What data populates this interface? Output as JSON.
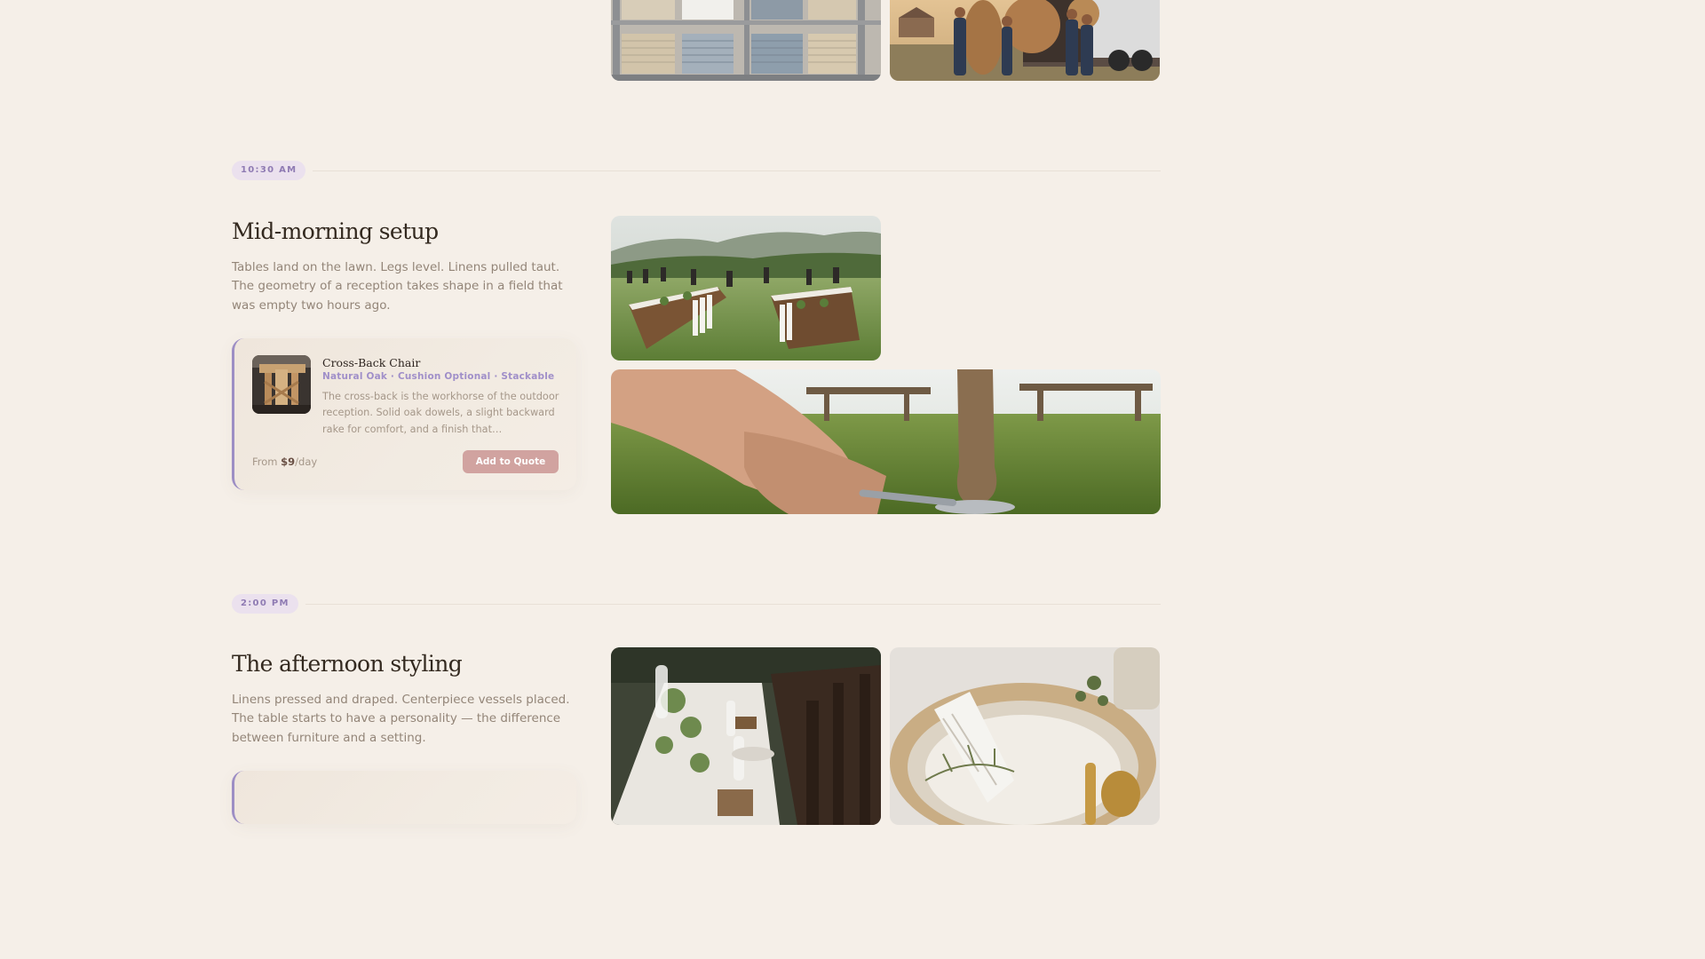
{
  "sections": [
    {
      "time": "10:30 AM",
      "title": "Mid-morning setup",
      "description": "Tables land on the lawn. Legs level. Linens pulled taut. The geometry of a reception takes shape in a field that was empty two hours ago.",
      "product": {
        "name": "Cross-Back Chair",
        "tags": "Natural Oak · Cushion Optional · Stackable",
        "description": "The cross-back is the workhorse of the outdoor reception. Solid oak dowels, a slight backward rake for comfort, and a finish that…",
        "price_prefix": "From ",
        "price": "$9",
        "price_unit": "/day",
        "button_label": "Add to Quote"
      }
    },
    {
      "time": "2:00 PM",
      "title": "The afternoon styling",
      "description": "Linens pressed and draped. Centerpiece vessels placed. The table starts to have a personality — the difference between furniture and a setting."
    }
  ],
  "colors": {
    "background": "#f5efe8",
    "accent_lavender": "#9d8ec4",
    "button": "#d1a3a0"
  }
}
